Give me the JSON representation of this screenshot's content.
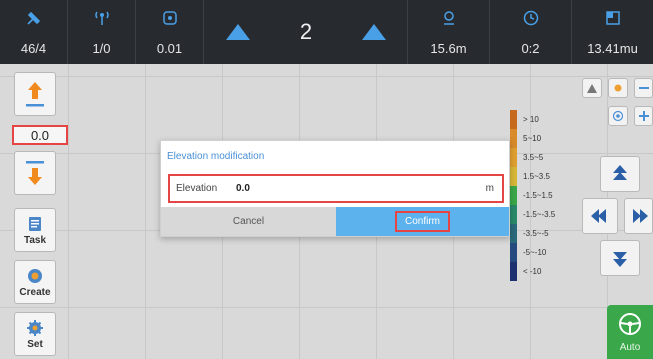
{
  "topbar": {
    "satellites": "46/4",
    "signal": "1/0",
    "accuracy": "0.01",
    "line_number": "2",
    "distance": "15.6m",
    "time": "0:2",
    "area": "13.41mu"
  },
  "left_toolbar": {
    "elevation_value": "0.0",
    "task_label": "Task",
    "create_label": "Create",
    "set_label": "Set"
  },
  "legend": {
    "items": [
      {
        "label": "> 10",
        "color": "#c86a1e"
      },
      {
        "label": "5~10",
        "color": "#d98a2a"
      },
      {
        "label": "3.5~5",
        "color": "#e0a030"
      },
      {
        "label": "1.5~3.5",
        "color": "#d8b838"
      },
      {
        "label": "-1.5~1.5",
        "color": "#3aa848"
      },
      {
        "label": "-1.5~-3.5",
        "color": "#2a8a6a"
      },
      {
        "label": "-3.5~-5",
        "color": "#2a6a7a"
      },
      {
        "label": "-5~-10",
        "color": "#264a80"
      },
      {
        "label": "< -10",
        "color": "#1e3070"
      }
    ]
  },
  "right_panel": {
    "auto_label": "Auto"
  },
  "dialog": {
    "title": "Elevation modification",
    "field_label": "Elevation",
    "field_value": "0.0",
    "unit": "m",
    "cancel_label": "Cancel",
    "confirm_label": "Confirm"
  },
  "colors": {
    "accent": "#4aa0e6",
    "highlight": "#e64545",
    "confirm_bg": "#5cb2ec",
    "auto_bg": "#3aa84a"
  }
}
